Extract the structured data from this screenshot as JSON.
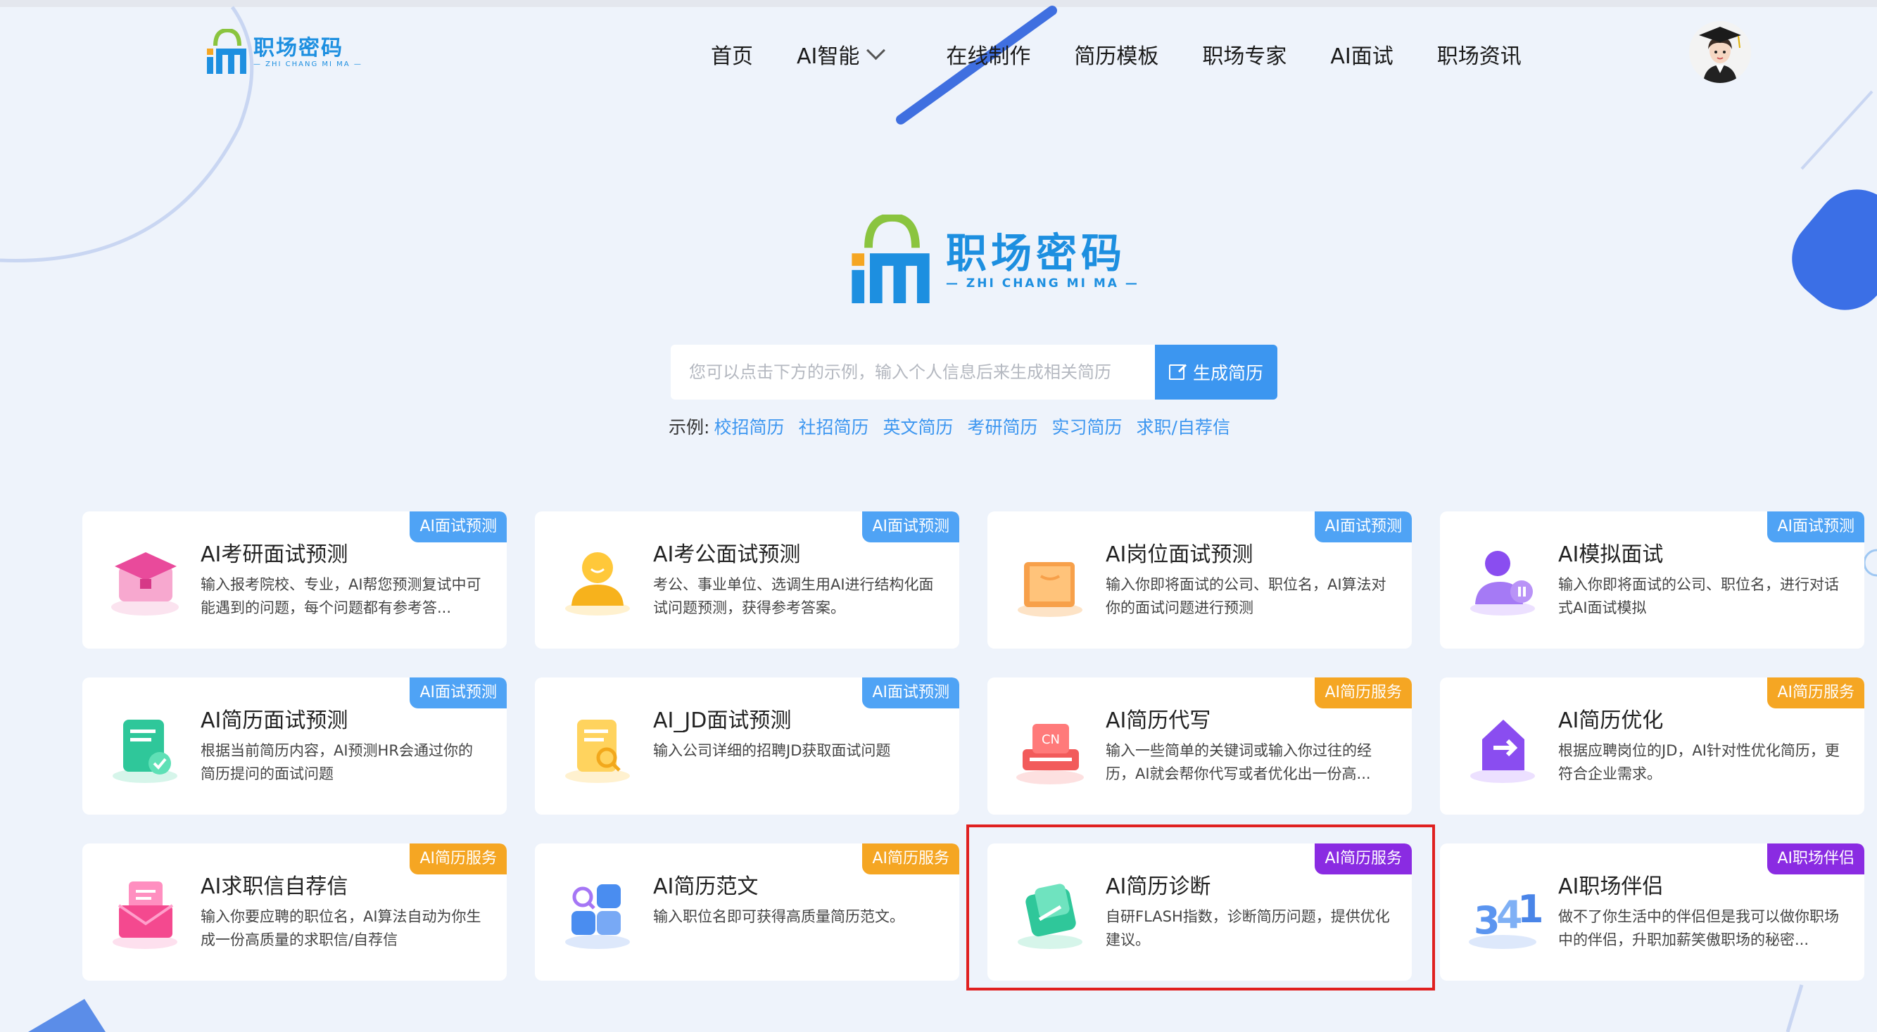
{
  "brand": {
    "name": "职场密码",
    "en": "— ZHI CHANG MI MA —"
  },
  "nav": [
    "首页",
    "AI智能",
    "在线制作",
    "简历模板",
    "职场专家",
    "AI面试",
    "职场资讯"
  ],
  "search": {
    "placeholder": "您可以点击下方的示例，输入个人信息后来生成相关简历",
    "button": "生成简历"
  },
  "examples": {
    "label": "示例:",
    "items": [
      "校招简历",
      "社招简历",
      "英文简历",
      "考研简历",
      "实习简历",
      "求职/自荐信"
    ]
  },
  "colors": {
    "blue_badge": "#4fa3f5",
    "orange_badge": "#f5a623",
    "purple_badge": "#8a2be2",
    "accent": "#3c96f0",
    "highlight": "#e02020"
  },
  "cards": [
    {
      "title": "AI考研面试预测",
      "desc": "输入报考院校、专业，AI帮您预测复试中可能遇到的问题，每个问题都有参考答...",
      "badge": "AI面试预测",
      "badge_color": "#4fa3f5",
      "icon": "graduation-cap-icon"
    },
    {
      "title": "AI考公面试预测",
      "desc": "考公、事业单位、选调生用AI进行结构化面试问题预测，获得参考答案。",
      "badge": "AI面试预测",
      "badge_color": "#4fa3f5",
      "icon": "person-icon"
    },
    {
      "title": "AI岗位面试预测",
      "desc": "输入你即将面试的公司、职位名，AI算法对你的面试问题进行预测",
      "badge": "AI面试预测",
      "badge_color": "#4fa3f5",
      "icon": "briefcase-icon"
    },
    {
      "title": "AI模拟面试",
      "desc": "输入你即将面试的公司、职位名，进行对话式AI面试模拟",
      "badge": "AI面试预测",
      "badge_color": "#4fa3f5",
      "icon": "interviewer-icon"
    },
    {
      "title": "AI简历面试预测",
      "desc": "根据当前简历内容，AI预测HR会通过你的简历提问的面试问题",
      "badge": "AI面试预测",
      "badge_color": "#4fa3f5",
      "icon": "resume-check-icon"
    },
    {
      "title": "AI_JD面试预测",
      "desc": "输入公司详细的招聘JD获取面试问题",
      "badge": "AI面试预测",
      "badge_color": "#4fa3f5",
      "icon": "document-search-icon"
    },
    {
      "title": "AI简历代写",
      "desc": "输入一些简单的关键词或输入你过往的经历，AI就会帮你代写或者优化出一份高...",
      "badge": "AI简历服务",
      "badge_color": "#f5a623",
      "icon": "typewriter-icon",
      "icon_text": "CN"
    },
    {
      "title": "AI简历优化",
      "desc": "根据应聘岗位的JD，AI针对性优化简历，更符合企业需求。",
      "badge": "AI简历服务",
      "badge_color": "#f5a623",
      "icon": "optimize-icon"
    },
    {
      "title": "AI求职信自荐信",
      "desc": "输入你要应聘的职位名，AI算法自动为你生成一份高质量的求职信/自荐信",
      "badge": "AI简历服务",
      "badge_color": "#f5a623",
      "icon": "envelope-icon"
    },
    {
      "title": "AI简历范文",
      "desc": "输入职位名即可获得高质量简历范文。",
      "badge": "AI简历服务",
      "badge_color": "#f5a623",
      "icon": "blocks-icon"
    },
    {
      "title": "AI简历诊断",
      "desc": "自研FLASH指数，诊断简历问题，提供优化建议。",
      "badge": "AI简历服务",
      "badge_color": "#8a2be2",
      "icon": "diagnosis-icon"
    },
    {
      "title": "AI职场伴侣",
      "desc": "做不了你生活中的伴侣但是我可以做你职场中的伴侣，升职加薪笑傲职场的秘密...",
      "badge": "AI职场伴侣",
      "badge_color": "#8a2be2",
      "icon": "numbers-3d-icon"
    }
  ]
}
